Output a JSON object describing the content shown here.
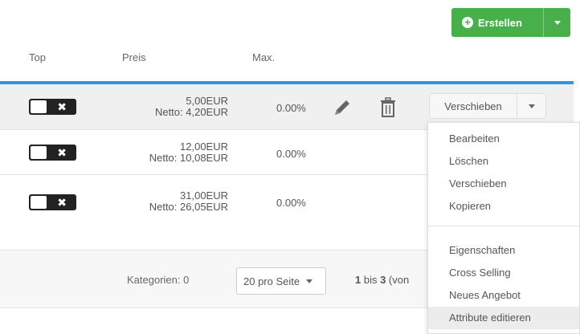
{
  "toolbar": {
    "create_label": "Erstellen"
  },
  "table": {
    "headers": {
      "top": "Top",
      "price": "Preis",
      "max": "Max."
    },
    "rows": [
      {
        "price": "5,00EUR",
        "net": "Netto: 4,20EUR",
        "max": "0.00%"
      },
      {
        "price": "12,00EUR",
        "net": "Netto: 10,08EUR",
        "max": "0.00%"
      },
      {
        "price": "31,00EUR",
        "net": "Netto: 26,05EUR",
        "max": "0.00%"
      }
    ],
    "move_label": "Verschieben"
  },
  "dropdown": {
    "items": [
      "Bearbeiten",
      "Löschen",
      "Verschieben",
      "Kopieren",
      "Eigenschaften",
      "Cross Selling",
      "Neues Angebot",
      "Attribute editieren"
    ]
  },
  "footer": {
    "categories": "Kategorien: 0",
    "per_page": "20 pro Seite",
    "range_from": "1",
    "range_middle": " bis ",
    "range_to": "3",
    "range_suffix": " (von"
  },
  "colors": {
    "primary": "#48b04b",
    "accent": "#2b96ea"
  }
}
